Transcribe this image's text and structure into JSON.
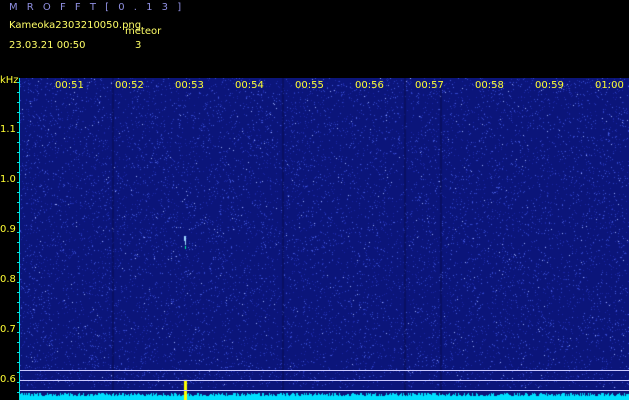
{
  "header": {
    "title": "M R O F F T   [ 0 . 1 3 ]",
    "filename": "Kameoka2303210050.png",
    "meteor_label": "meteor",
    "datetime": "23.03.21 00:50",
    "meteor_count": "3"
  },
  "axis": {
    "unit": "kHz",
    "freq_labels": [
      "1.1",
      "1.0",
      "0.9",
      "0.8",
      "0.7",
      "0.6"
    ],
    "time_labels": [
      "00:51",
      "00:52",
      "00:53",
      "00:54",
      "00:55",
      "00:56",
      "00:57",
      "00:58",
      "00:59",
      "01:00"
    ]
  },
  "colors": {
    "background": "#0b157a",
    "noise": "#4a5fe0",
    "text": "#ffff33",
    "title": "#8f8fe0",
    "signal": "#00e0ff",
    "meteor": "#ffff00"
  }
}
